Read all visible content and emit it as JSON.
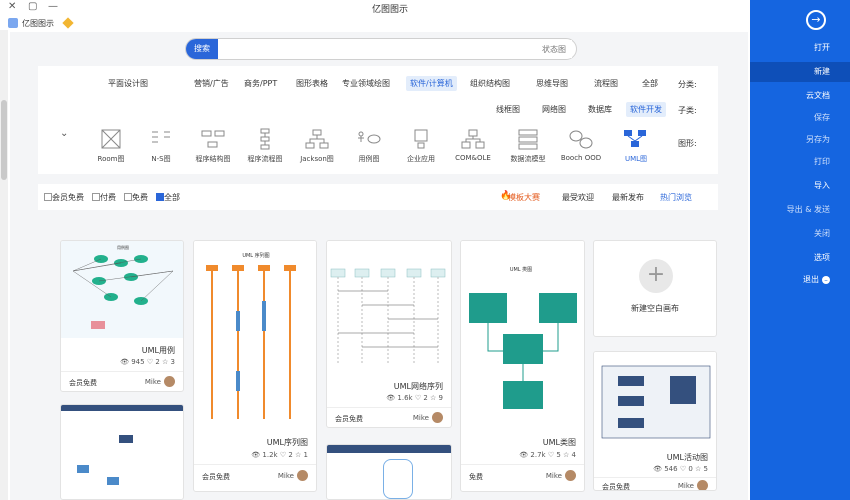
{
  "window": {
    "title": "亿图图示",
    "min": "—",
    "max": "▢",
    "close": "✕"
  },
  "brand": "亿图图示",
  "search": {
    "button": "搜索",
    "placeholder": "状态图"
  },
  "filters": {
    "category_label": "分类:",
    "categories": [
      "全部",
      "流程图",
      "思维导图",
      "组织结构图",
      "专业领域绘图",
      "软件/计算机",
      "图形表格",
      "商务/PPT",
      "营销/广告",
      "平面设计图"
    ],
    "category_active": 5,
    "sub_label": "子类:",
    "subs": [
      "软件开发",
      "数据库",
      "网络图",
      "线框图"
    ],
    "sub_active": 0,
    "shape_label": "图形:",
    "shapes": [
      "UML图",
      "Booch OOD",
      "数据流模型",
      "COM&OLE",
      "企业应用",
      "用例图",
      "Jackson图",
      "程序流程图",
      "程序结构图",
      "N-S图",
      "Room图"
    ]
  },
  "sort": {
    "items": [
      "热门浏览",
      "最新发布",
      "最受欢迎",
      "模板大赛"
    ],
    "filter": [
      "全部",
      "免费",
      "付费",
      "会员免费"
    ]
  },
  "sidebar": {
    "items": [
      "打开",
      "新建",
      "云文档",
      "保存",
      "另存为",
      "打印",
      "导入",
      "导出 & 发送",
      "关闭",
      "选项",
      "退出"
    ],
    "selected": 1
  },
  "cards": [
    {
      "title": "新建空白画布"
    },
    {
      "title": "UML类图",
      "views": "2.7k",
      "likes": "5",
      "favs": "4",
      "author": "Mike",
      "price": "免费"
    },
    {
      "title": "UML网络序列",
      "views": "1.6k",
      "likes": "2",
      "favs": "9",
      "author": "Mike",
      "price": "会员免费"
    },
    {
      "title": "UML序列图",
      "views": "1.2k",
      "likes": "2",
      "favs": "1",
      "author": "Mike",
      "price": "会员免费"
    },
    {
      "title": "UML用例",
      "views": "945",
      "likes": "2",
      "favs": "3",
      "author": "Mike",
      "price": "会员免费"
    },
    {
      "title": "UML活动图",
      "views": "546",
      "likes": "0",
      "favs": "5",
      "author": "Mike",
      "price": "会员免费"
    }
  ],
  "thumb_labels": {
    "class": "UML 类图",
    "seq": "UML 序列图",
    "usecase": "用例图"
  }
}
